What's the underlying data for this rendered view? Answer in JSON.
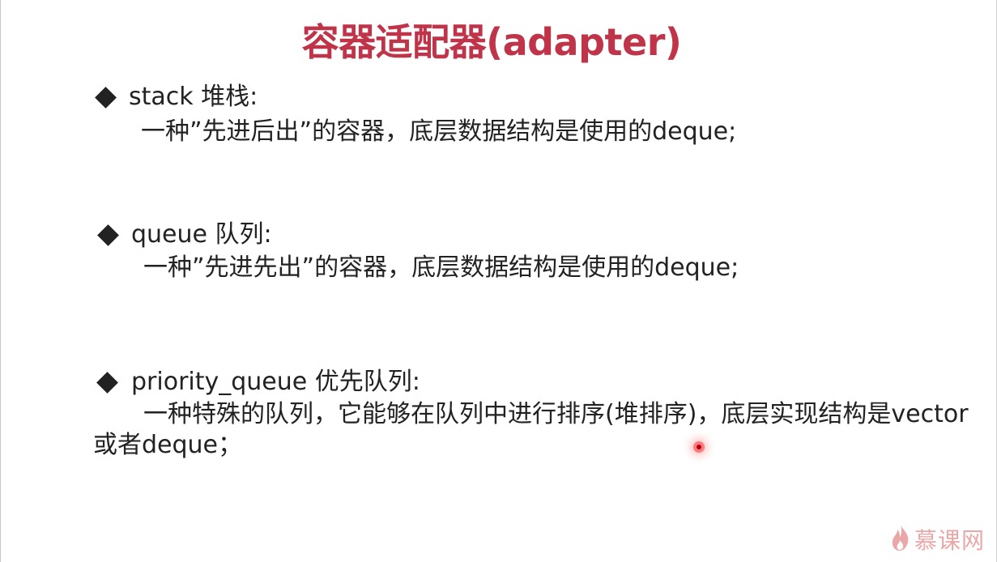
{
  "slide": {
    "title": "容器适配器(adapter)",
    "sections": [
      {
        "heading": "stack 堆栈:",
        "body": "一种”先进后出”的容器，底层数据结构是使用的deque;"
      },
      {
        "heading": "queue 队列:",
        "body": "一种”先进先出”的容器，底层数据结构是使用的deque;"
      },
      {
        "heading": "priority_queue 优先队列:",
        "body_line1": "一种特殊的队列，它能够在队列中进行排序(堆排序)，底层实现结构是vector",
        "body_line2": "或者deque；"
      }
    ]
  },
  "watermark": {
    "text": "慕课网",
    "icon": "flame-logo-icon"
  },
  "colors": {
    "title": "#c0344a",
    "body_text": "#222222",
    "watermark": "#d86060",
    "pointer": "#ff7b7b"
  }
}
